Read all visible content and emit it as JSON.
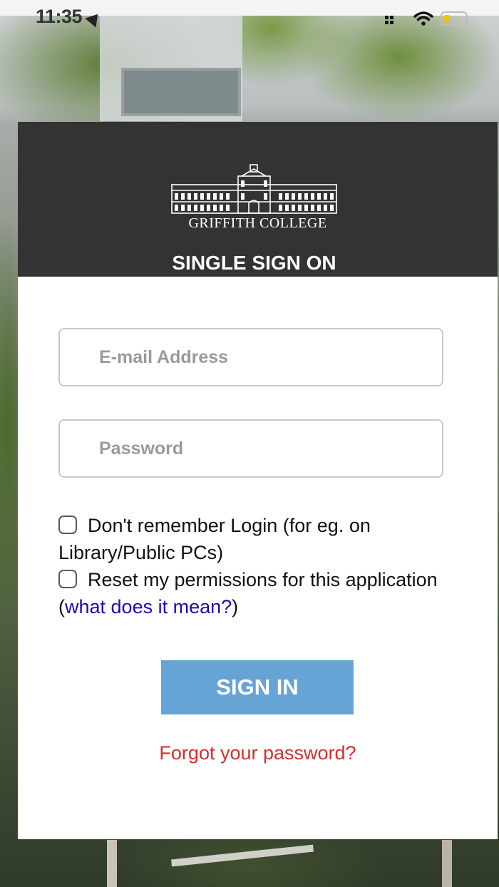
{
  "status_bar": {
    "time": "11:35"
  },
  "header": {
    "college_name": "GRIFFITH COLLEGE",
    "title": "SINGLE SIGN ON"
  },
  "form": {
    "email_placeholder": "E-mail Address",
    "email_value": "",
    "password_placeholder": "Password",
    "password_value": "",
    "checkbox_dont_remember": {
      "label": "Don't remember Login (for eg. on Library/Public PCs)",
      "checked": false
    },
    "checkbox_reset_permissions": {
      "label": "Reset my permissions for this application",
      "checked": false
    },
    "paren_open": "(",
    "what_does_it_mean_link": "what does it mean?",
    "paren_close": ")",
    "sign_in_label": "SIGN IN",
    "forgot_password_link": "Forgot your password?"
  },
  "colors": {
    "header_bg": "#333333",
    "sign_in_bg": "#65a4d4",
    "forgot_link": "#d0312d",
    "info_link": "#1a0dab"
  }
}
